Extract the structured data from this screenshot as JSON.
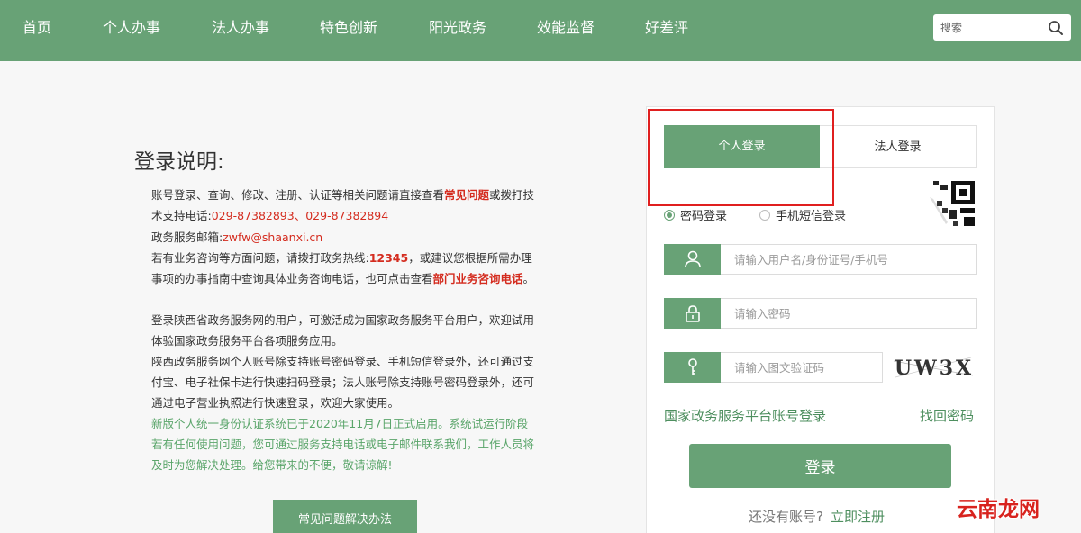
{
  "nav": {
    "items": [
      {
        "label": "首页"
      },
      {
        "label": "个人办事"
      },
      {
        "label": "法人办事"
      },
      {
        "label": "特色创新"
      },
      {
        "label": "阳光政务"
      },
      {
        "label": "效能监督"
      },
      {
        "label": "好差评"
      }
    ],
    "search_placeholder": "搜索",
    "search_icon": "search-icon"
  },
  "instructions": {
    "title": "登录说明:",
    "p1_a": "账号登录、查询、修改、注册、认证等相关问题请直接查看",
    "p1_link": "常见问题",
    "p1_b": "或拨打技术支持电话:",
    "p1_phone": "029-87382893、029-87382894",
    "p2_label": "政务服务邮箱:",
    "p2_email": "zwfw@shaanxi.cn",
    "p3_a": "若有业务咨询等方面问题，请拨打政务热线:",
    "p3_hotline": "12345",
    "p3_b": "，或建议您根据所需办理事项的办事指南中查询具体业务咨询电话，也可点击查看",
    "p3_link": "部门业务咨询电话",
    "p3_end": "。",
    "p4": "登录陕西省政务服务网的用户，可激活成为国家政务服务平台用户，欢迎试用体验国家政务服务平台各项服务应用。",
    "p5": "陕西政务服务网个人账号除支持账号密码登录、手机短信登录外，还可通过支付宝、电子社保卡进行快速扫码登录；法人账号除支持账号密码登录外，还可通过电子营业执照进行快速登录，欢迎大家使用。",
    "p6": "新版个人统一身份认证系统已于2020年11月7日正式启用。系统试运行阶段若有任何使用问题，您可通过服务支持电话或电子邮件联系我们，工作人员将及时为您解决处理。给您带来的不便，敬请谅解!",
    "faq_button": "常见问题解决办法"
  },
  "login": {
    "tabs": [
      {
        "label": "个人登录",
        "active": true
      },
      {
        "label": "法人登录",
        "active": false
      }
    ],
    "methods": [
      {
        "label": "密码登录",
        "selected": true
      },
      {
        "label": "手机短信登录",
        "selected": false
      }
    ],
    "username_placeholder": "请输入用户名/身份证号/手机号",
    "password_placeholder": "请输入密码",
    "captcha_placeholder": "请输入图文验证码",
    "captcha_text": "UW3X",
    "national_link": "国家政务服务平台账号登录",
    "forgot_link": "找回密码",
    "submit_label": "登录",
    "no_account": "还没有账号?",
    "register_link": "立即注册"
  },
  "watermark": "云南龙网",
  "colors": {
    "brand": "#68a276",
    "link": "#4e8f5f",
    "accent_red": "#d42c1f",
    "highlight": "#e01f1f"
  }
}
